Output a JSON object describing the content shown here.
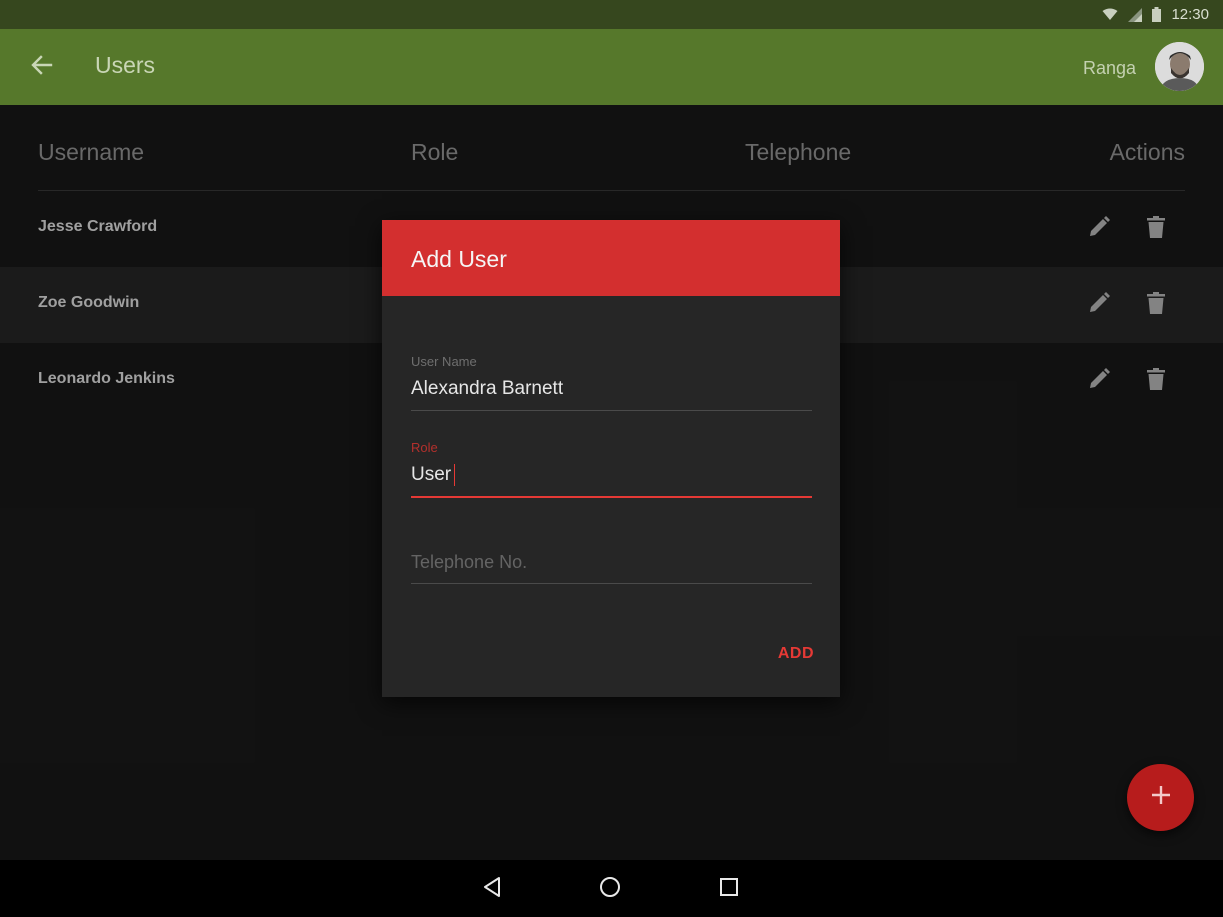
{
  "status_bar": {
    "time": "12:30",
    "icons": [
      "wifi-icon",
      "signal-icon",
      "battery-icon"
    ]
  },
  "app_bar": {
    "title": "Users",
    "user_name": "Ranga",
    "back_icon": "arrow-left-icon",
    "color": "#56782b"
  },
  "table": {
    "columns": [
      "Username",
      "Role",
      "Telephone",
      "Actions"
    ],
    "rows": [
      {
        "username": "Jesse Crawford"
      },
      {
        "username": "Zoe Goodwin"
      },
      {
        "username": "Leonardo Jenkins"
      }
    ],
    "action_icons": [
      "pencil-icon",
      "trash-icon"
    ]
  },
  "dialog": {
    "title": "Add User",
    "header_color": "#d32f2f",
    "fields": {
      "user_name": {
        "label": "User Name",
        "value": "Alexandra Barnett"
      },
      "role": {
        "label": "Role",
        "value": "User"
      },
      "telephone": {
        "placeholder": "Telephone No."
      }
    },
    "add_label": "ADD"
  },
  "fab": {
    "icon": "plus-icon",
    "color": "#b71c1c"
  },
  "nav_bar": {
    "icons": [
      "back-triangle-icon",
      "home-circle-icon",
      "recents-square-icon"
    ]
  }
}
